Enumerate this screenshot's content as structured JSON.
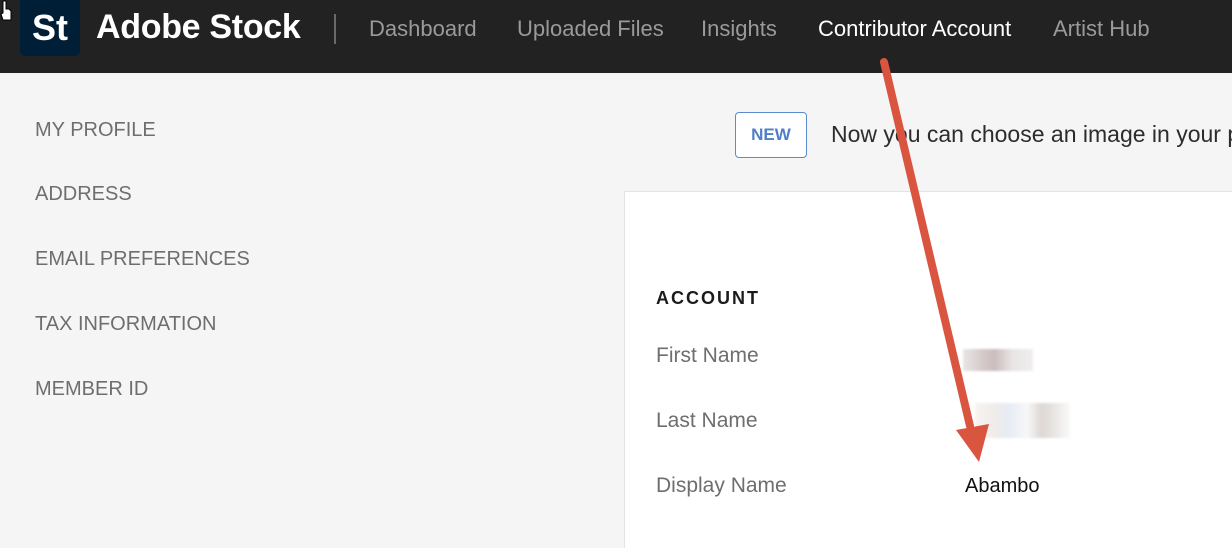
{
  "header": {
    "logo_text": "St",
    "brand": "Adobe Stock",
    "nav": [
      {
        "label": "Dashboard",
        "active": false
      },
      {
        "label": "Uploaded Files",
        "active": false
      },
      {
        "label": "Insights",
        "active": false
      },
      {
        "label": "Contributor Account",
        "active": true
      },
      {
        "label": "Artist Hub",
        "active": false
      }
    ]
  },
  "sidebar": {
    "items": [
      {
        "label": "MY PROFILE"
      },
      {
        "label": "ADDRESS"
      },
      {
        "label": "EMAIL PREFERENCES"
      },
      {
        "label": "TAX INFORMATION"
      },
      {
        "label": "MEMBER ID"
      }
    ]
  },
  "banner": {
    "badge": "NEW",
    "text": "Now you can choose an image in your p"
  },
  "account": {
    "title": "ACCOUNT",
    "fields": [
      {
        "label": "First Name",
        "value": ""
      },
      {
        "label": "Last Name",
        "value": ""
      },
      {
        "label": "Display Name",
        "value": "Abambo"
      }
    ]
  },
  "colors": {
    "topbar": "#222222",
    "logo_tile": "#001e36",
    "badge_border": "#5a8ad0",
    "annotation_arrow": "#d9553f"
  }
}
